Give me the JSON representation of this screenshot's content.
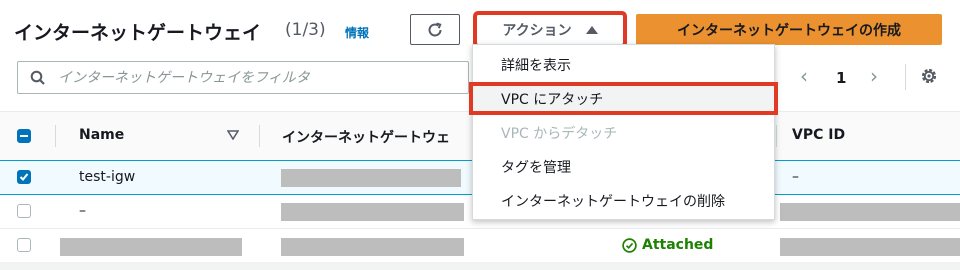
{
  "header": {
    "title": "インターネットゲートウェイ",
    "count": "(1/3)",
    "info": "情報",
    "actions_label": "アクション",
    "create_label": "インターネットゲートウェイの作成"
  },
  "filter": {
    "placeholder": "インターネットゲートウェイをフィルタ"
  },
  "pagination": {
    "prev": "‹",
    "page": "1",
    "next": "›"
  },
  "table": {
    "columns": [
      "Name",
      "インターネットゲートウェ",
      "VPC ID"
    ],
    "rows": [
      {
        "selected": true,
        "name": "test-igw",
        "vpc_id": "–"
      },
      {
        "selected": false,
        "name": "–"
      },
      {
        "selected": false,
        "state": "Attached"
      }
    ]
  },
  "menu": {
    "items": [
      {
        "label": "詳細を表示",
        "enabled": true
      },
      {
        "label": "VPC にアタッチ",
        "enabled": true
      },
      {
        "label": "VPC からデタッチ",
        "enabled": false
      },
      {
        "label": "タグを管理",
        "enabled": true
      },
      {
        "label": "インターネットゲートウェイの削除",
        "enabled": true
      }
    ]
  },
  "colors": {
    "accent": "#ec912f",
    "highlight": "#e03a25",
    "link": "#0073bb",
    "success": "#1d8102"
  }
}
